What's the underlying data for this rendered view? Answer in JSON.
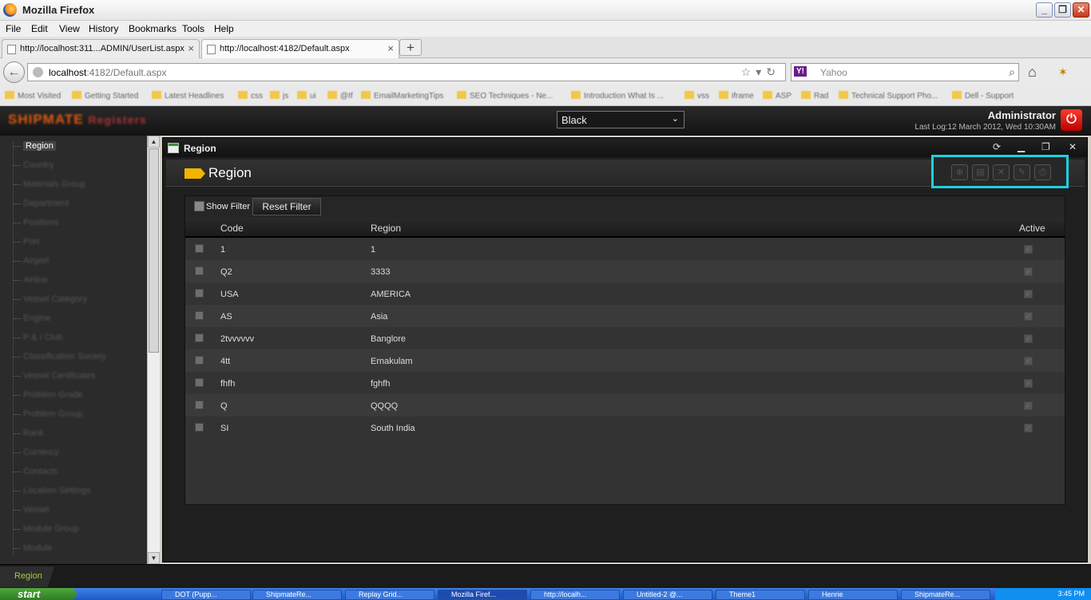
{
  "window": {
    "title": "Mozilla Firefox"
  },
  "menu": [
    "File",
    "Edit",
    "View",
    "History",
    "Bookmarks",
    "Tools",
    "Help"
  ],
  "tabs": [
    {
      "label": "http://localhost:311...ADMIN/UserList.aspx",
      "active": false
    },
    {
      "label": "http://localhost:4182/Default.aspx",
      "active": true
    }
  ],
  "newtab": "+",
  "url": {
    "host": "localhost",
    "path": ":4182/Default.aspx"
  },
  "search": {
    "placeholder": "Yahoo",
    "engine_badge": "Y!"
  },
  "bookmarks": [
    "Most Visited",
    "Getting Started",
    "Latest Headlines",
    "css",
    "js",
    "ui",
    "@If",
    "EmailMarketingTips",
    "SEO Techniques - Ne...",
    "Introduction What Is ...",
    "vss",
    "iframe",
    "ASP",
    "Rad",
    "Technical Support Pho...",
    "Dell - Support"
  ],
  "app": {
    "logo": "SHIPMATE",
    "logo_sub": "Registers",
    "theme_selected": "Black",
    "user": "Administrator",
    "last_log": "Last Log:12 March 2012, Wed 10:30AM"
  },
  "sidebar": {
    "items": [
      "Region",
      "Country",
      "Materials Group",
      "Department",
      "Positions",
      "Port",
      "Airport",
      "Airline",
      "Vessel Category",
      "Engine",
      "P & I Club",
      "Classification Society",
      "Vessel Certificates",
      "Problem Grade",
      "Problem Group",
      "Rank",
      "Currency",
      "Contacts",
      "Location Settings",
      "Vessel",
      "Module Group",
      "Module"
    ]
  },
  "panel": {
    "title": "Region",
    "page_heading": "Region",
    "controls": [
      "⟳",
      "▁",
      "❐",
      "✕"
    ],
    "toolbar_buttons": [
      "new",
      "save",
      "delete",
      "edit",
      "print"
    ]
  },
  "grid": {
    "show_filter": "Show Filter",
    "reset_filter": "Reset Filter",
    "columns": [
      "Code",
      "Region",
      "Active"
    ],
    "rows": [
      {
        "code": "1",
        "region": "1"
      },
      {
        "code": "Q2",
        "region": "3333"
      },
      {
        "code": "USA",
        "region": "AMERICA"
      },
      {
        "code": "AS",
        "region": "Asia"
      },
      {
        "code": "2tvvvvvv",
        "region": "Banglore"
      },
      {
        "code": "4tt",
        "region": "Ernakulam"
      },
      {
        "code": "fhfh",
        "region": "fghfh"
      },
      {
        "code": "Q",
        "region": "QQQQ"
      },
      {
        "code": "SI",
        "region": "South India"
      }
    ]
  },
  "bottom_tab": "Region",
  "taskbar": {
    "start": "start",
    "tasks": [
      "DOT (Pupp...",
      "ShipmateRe...",
      "Replay Grid...",
      "Mozilla Firef...",
      "http://localh...",
      "Untitled-2 @...",
      "Theme1",
      "Henrie",
      "ShipmateRe..."
    ],
    "clock": "3:45 PM"
  }
}
